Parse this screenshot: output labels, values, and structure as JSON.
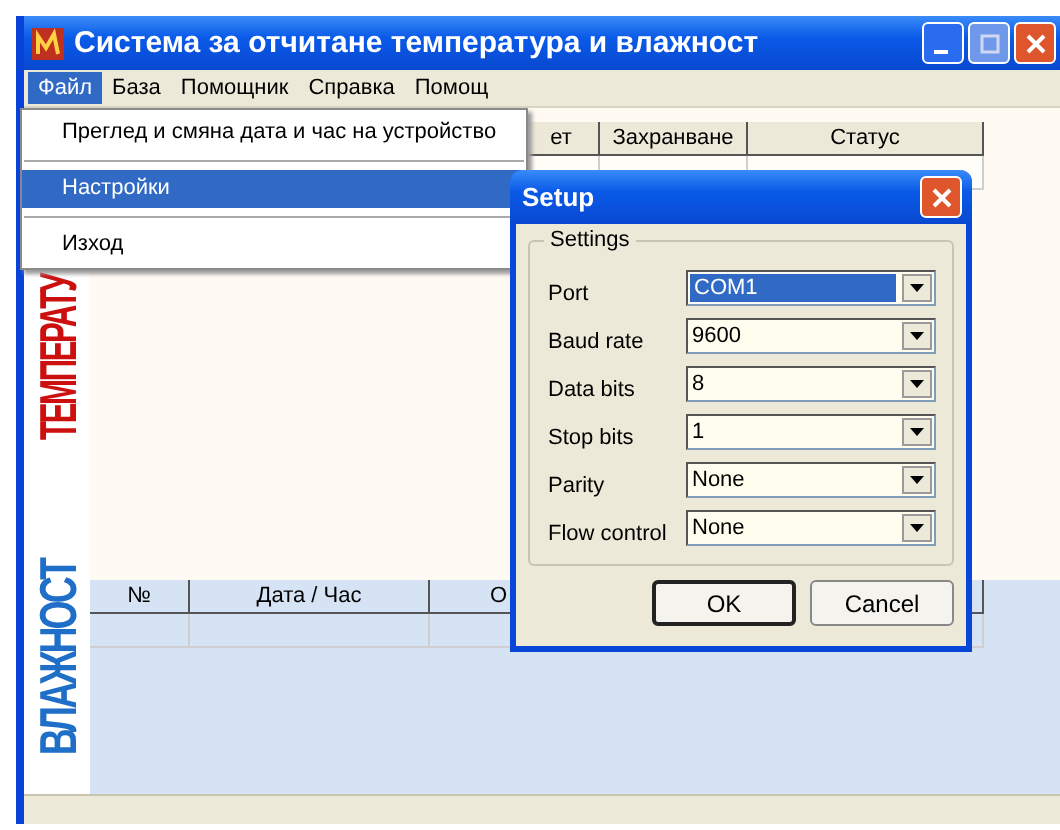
{
  "window": {
    "title": "Система за отчитане температура и влажност"
  },
  "menu_bar": [
    {
      "label": "Файл",
      "selected": true
    },
    {
      "label": "База",
      "selected": false
    },
    {
      "label": "Помощник",
      "selected": false
    },
    {
      "label": "Справка",
      "selected": false
    },
    {
      "label": "Помощ",
      "selected": false
    }
  ],
  "file_menu": [
    {
      "kind": "item",
      "label": "Преглед и смяна дата и час на устройство",
      "selected": false
    },
    {
      "kind": "separator"
    },
    {
      "kind": "item",
      "label": "Настройки",
      "selected": true
    },
    {
      "kind": "separator"
    },
    {
      "kind": "item",
      "label": "Изход",
      "selected": false
    }
  ],
  "temperature": {
    "label": "ТЕМПЕРАТУ",
    "columns": [
      "ет",
      "Захранване",
      "Статус"
    ]
  },
  "humidity": {
    "label": "ВЛАЖНОСТ",
    "columns": [
      "№",
      "Дата / Час",
      "О"
    ]
  },
  "dialog": {
    "title": "Setup",
    "group": "Settings",
    "fields": [
      {
        "label": "Port",
        "value": "COM1",
        "focused": true
      },
      {
        "label": "Baud rate",
        "value": "9600",
        "focused": false
      },
      {
        "label": "Data bits",
        "value": "8",
        "focused": false
      },
      {
        "label": "Stop bits",
        "value": "1",
        "focused": false
      },
      {
        "label": "Parity",
        "value": "None",
        "focused": false
      },
      {
        "label": "Flow control",
        "value": "None",
        "focused": false
      }
    ],
    "buttons": [
      {
        "label": "OK",
        "default": true
      },
      {
        "label": "Cancel",
        "default": false
      }
    ]
  }
}
